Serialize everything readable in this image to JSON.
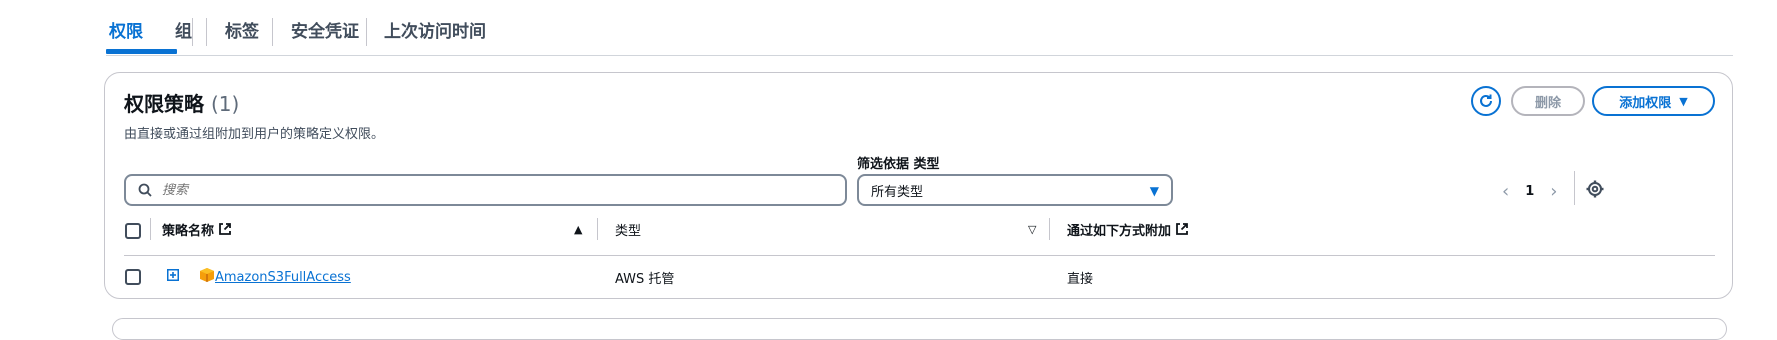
{
  "tabs": [
    {
      "label": "权限"
    },
    {
      "label": "组"
    },
    {
      "label": "标签"
    },
    {
      "label": "安全凭证"
    },
    {
      "label": "上次访问时间"
    }
  ],
  "panel": {
    "title": "权限策略",
    "count": "(1)",
    "description": "由直接或通过组附加到用户的策略定义权限。",
    "delete_label": "删除",
    "add_label": "添加权限",
    "filter_label": "筛选依据 类型",
    "search_placeholder": "搜索",
    "select_value": "所有类型",
    "page_number": "1"
  },
  "table": {
    "columns": [
      "策略名称",
      "类型",
      "通过如下方式附加"
    ],
    "rows": [
      {
        "name": "AmazonS3FullAccess",
        "type": "AWS 托管",
        "attached_via": "直接"
      }
    ]
  },
  "colors": {
    "accent": "#0972d3",
    "border": "#c6c6cd",
    "package_icon": "#f59e0b"
  }
}
